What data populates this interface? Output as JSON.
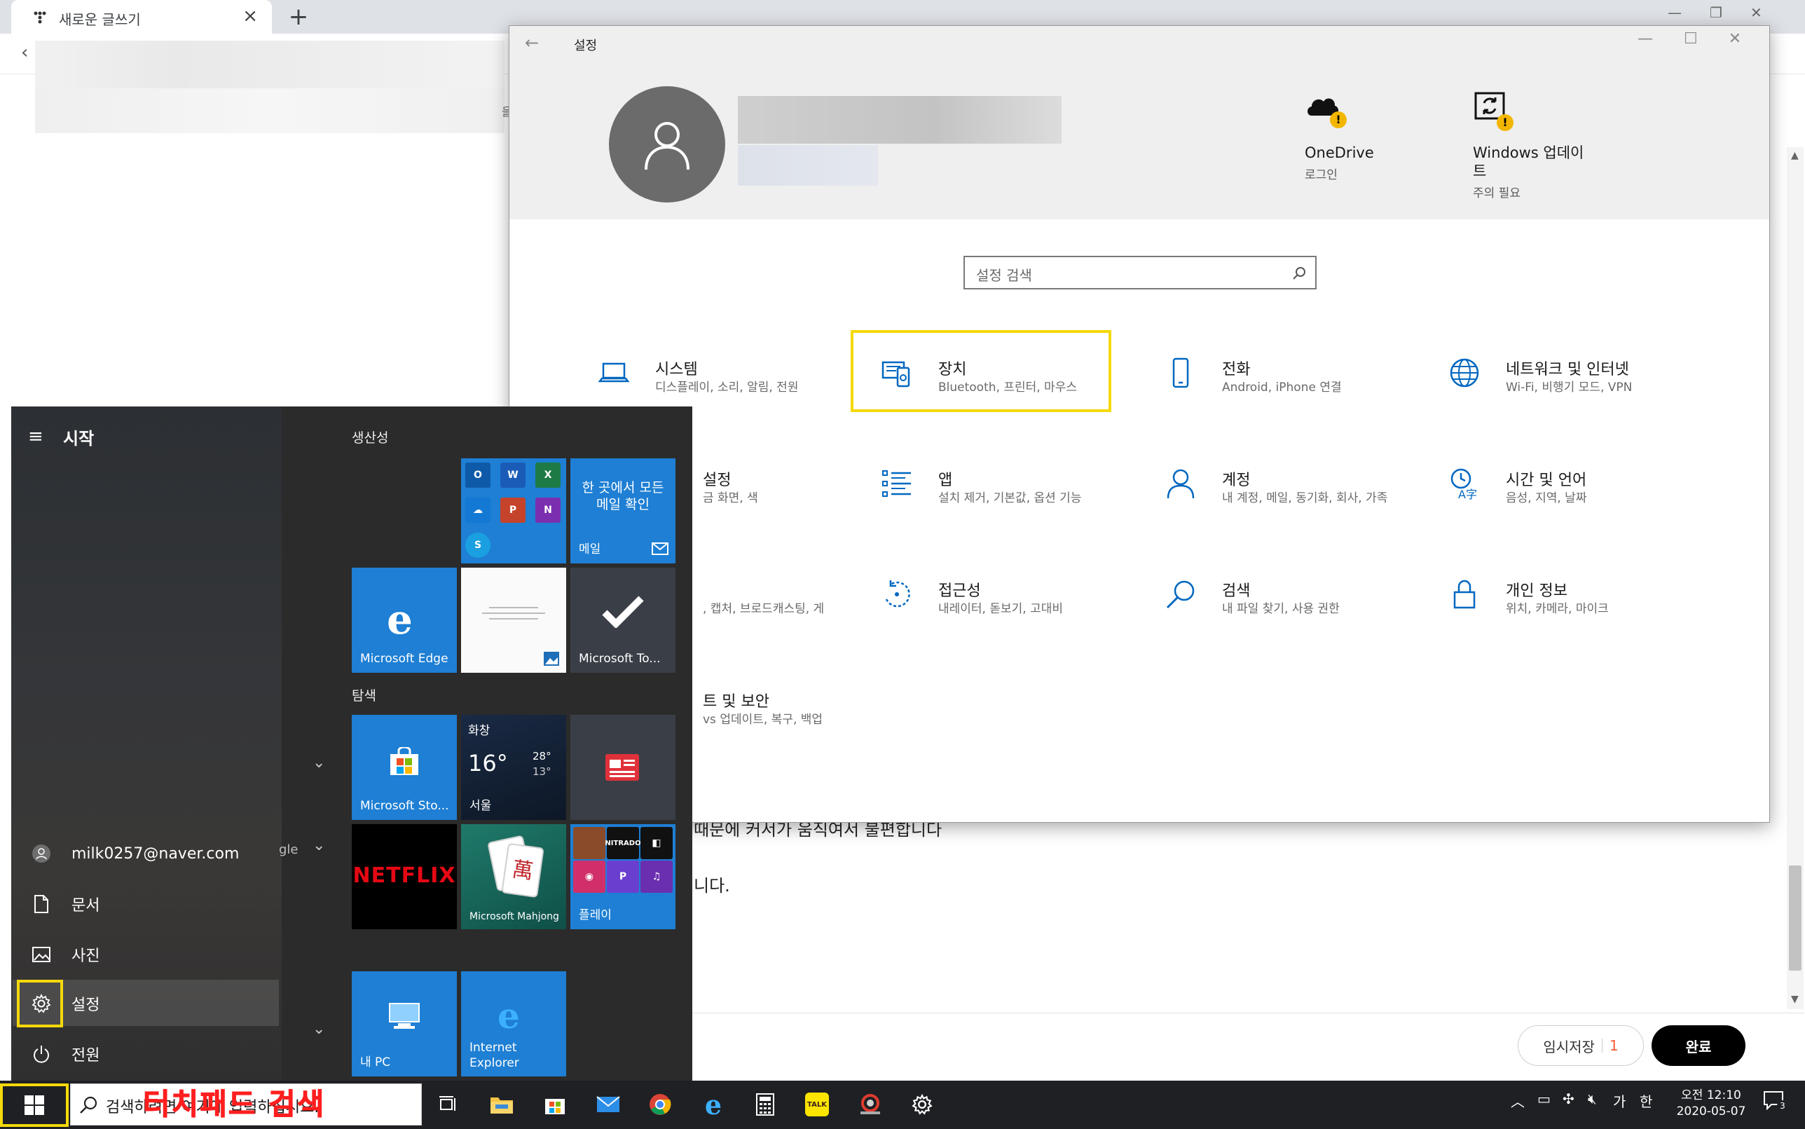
{
  "browser": {
    "tab_title": "새로운 글쓰기",
    "tab_close": "×",
    "new_tab": "+",
    "back": "‹",
    "doc_line_1": "때문에 커서가 움직여서 불편합니다",
    "doc_line_2": "니다.",
    "doc_fragment_left": "gle",
    "doc_fragment_top": "을",
    "save_draft_label": "임시저장",
    "save_draft_count": "1",
    "complete_label": "완료"
  },
  "settings": {
    "window_title": "설정",
    "search_placeholder": "설정 검색",
    "onedrive": {
      "title": "OneDrive",
      "sub": "로그인"
    },
    "windows_update": {
      "title_line1": "Windows 업데이",
      "title_line2": "트",
      "sub": "주의 필요"
    },
    "categories": [
      {
        "title": "시스템",
        "sub": "디스플레이, 소리, 알림, 전원",
        "icon": "laptop-icon"
      },
      {
        "title": "장치",
        "sub": "Bluetooth, 프린터, 마우스",
        "icon": "devices-icon"
      },
      {
        "title": "전화",
        "sub": "Android, iPhone 연결",
        "icon": "phone-icon"
      },
      {
        "title": "네트워크 및 인터넷",
        "sub": "Wi-Fi, 비행기 모드, VPN",
        "icon": "globe-icon"
      },
      {
        "title": "설정",
        "sub": "금 화면, 색",
        "icon": "personalization-icon"
      },
      {
        "title": "앱",
        "sub": "설치 제거, 기본값, 옵션 기능",
        "icon": "apps-icon"
      },
      {
        "title": "계정",
        "sub": "내 계정, 메일, 동기화, 회사, 가족",
        "icon": "person-icon"
      },
      {
        "title": "시간 및 언어",
        "sub": "음성, 지역, 날짜",
        "icon": "time-language-icon"
      },
      {
        "title": "",
        "sub": ", 캡처, 브로드캐스팅, 게",
        "icon": "gaming-icon"
      },
      {
        "title": "접근성",
        "sub": "내레이터, 돋보기, 고대비",
        "icon": "ease-of-access-icon"
      },
      {
        "title": "검색",
        "sub": "내 파일 찾기, 사용 권한",
        "icon": "search-icon"
      },
      {
        "title": "개인 정보",
        "sub": "위치, 카메라, 마이크",
        "icon": "lock-icon"
      },
      {
        "title": "트 및 보안",
        "sub": "vs 업데이트, 복구, 백업",
        "icon": "update-security-icon"
      }
    ]
  },
  "start_menu": {
    "title": "시작",
    "user": "milk0257@naver.com",
    "items": [
      {
        "label": "문서",
        "icon": "document-icon"
      },
      {
        "label": "사진",
        "icon": "pictures-icon"
      },
      {
        "label": "설정",
        "icon": "gear-icon"
      },
      {
        "label": "전원",
        "icon": "power-icon"
      }
    ],
    "group_productivity": "생산성",
    "group_explore": "탐색",
    "tiles": {
      "mail_text": "한 곳에서 모든 메일 확인",
      "mail_label": "메일",
      "edge": "Microsoft Edge",
      "todo": "Microsoft To...",
      "store": "Microsoft Sto...",
      "weather_cond": "화창",
      "weather_temp": "16°",
      "weather_high": "28°",
      "weather_low": "13°",
      "weather_city": "서울",
      "netflix": "NETFLIX",
      "mahjong": "Microsoft Mahjong",
      "play": "플레이",
      "nitrado": "NITRADO",
      "mypc": "내 PC",
      "ie": "Internet Explorer"
    }
  },
  "taskbar": {
    "search_placeholder": "검색하려면 여기에 입력하십시오.",
    "annotation": "터치패드 검색",
    "ime": "가",
    "ime2": "한",
    "time": "오전 12:10",
    "date": "2020-05-07",
    "notifications": "3"
  },
  "colors": {
    "highlight": "#f5d90a",
    "settings_accent": "#0067c0",
    "annotation": "#ff1f1f",
    "tile_blue": "#1e7fd4"
  }
}
